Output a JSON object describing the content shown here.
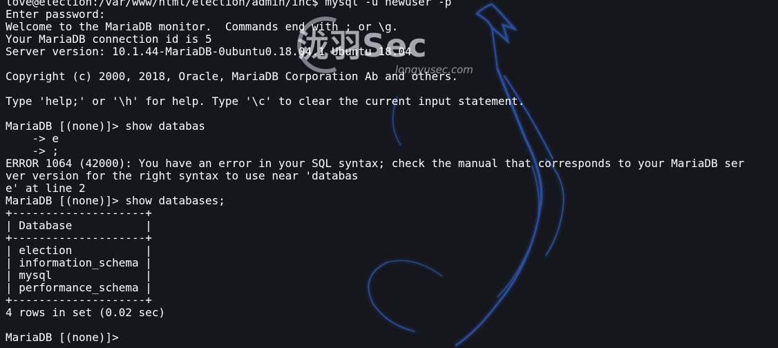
{
  "colors": {
    "background": "#15171d",
    "text": "#ffffff",
    "dragon": "#2b4f9e",
    "watermark": "#dfe3ea"
  },
  "watermark": {
    "text": "泷羽Sec",
    "url": "longyusec.com",
    "icon": "dragon-icon"
  },
  "terminal": {
    "lines": [
      "love@election:/var/www/html/election/admin/inc$ mysql -u newuser -p",
      "Enter password:",
      "Welcome to the MariaDB monitor.  Commands end with ; or \\g.",
      "Your MariaDB connection id is 5",
      "Server version: 10.1.44-MariaDB-0ubuntu0.18.04.1 Ubuntu 18.04",
      "",
      "Copyright (c) 2000, 2018, Oracle, MariaDB Corporation Ab and others.",
      "",
      "Type 'help;' or '\\h' for help. Type '\\c' to clear the current input statement.",
      "",
      "MariaDB [(none)]> show databas",
      "    -> e",
      "    -> ;",
      "ERROR 1064 (42000): You have an error in your SQL syntax; check the manual that corresponds to your MariaDB ser",
      "ver version for the right syntax to use near 'databas",
      "e' at line 2",
      "MariaDB [(none)]> show databases;",
      "+--------------------+",
      "| Database           |",
      "+--------------------+",
      "| election           |",
      "| information_schema |",
      "| mysql              |",
      "| performance_schema |",
      "+--------------------+",
      "4 rows in set (0.02 sec)",
      "",
      "MariaDB [(none)]>"
    ]
  }
}
